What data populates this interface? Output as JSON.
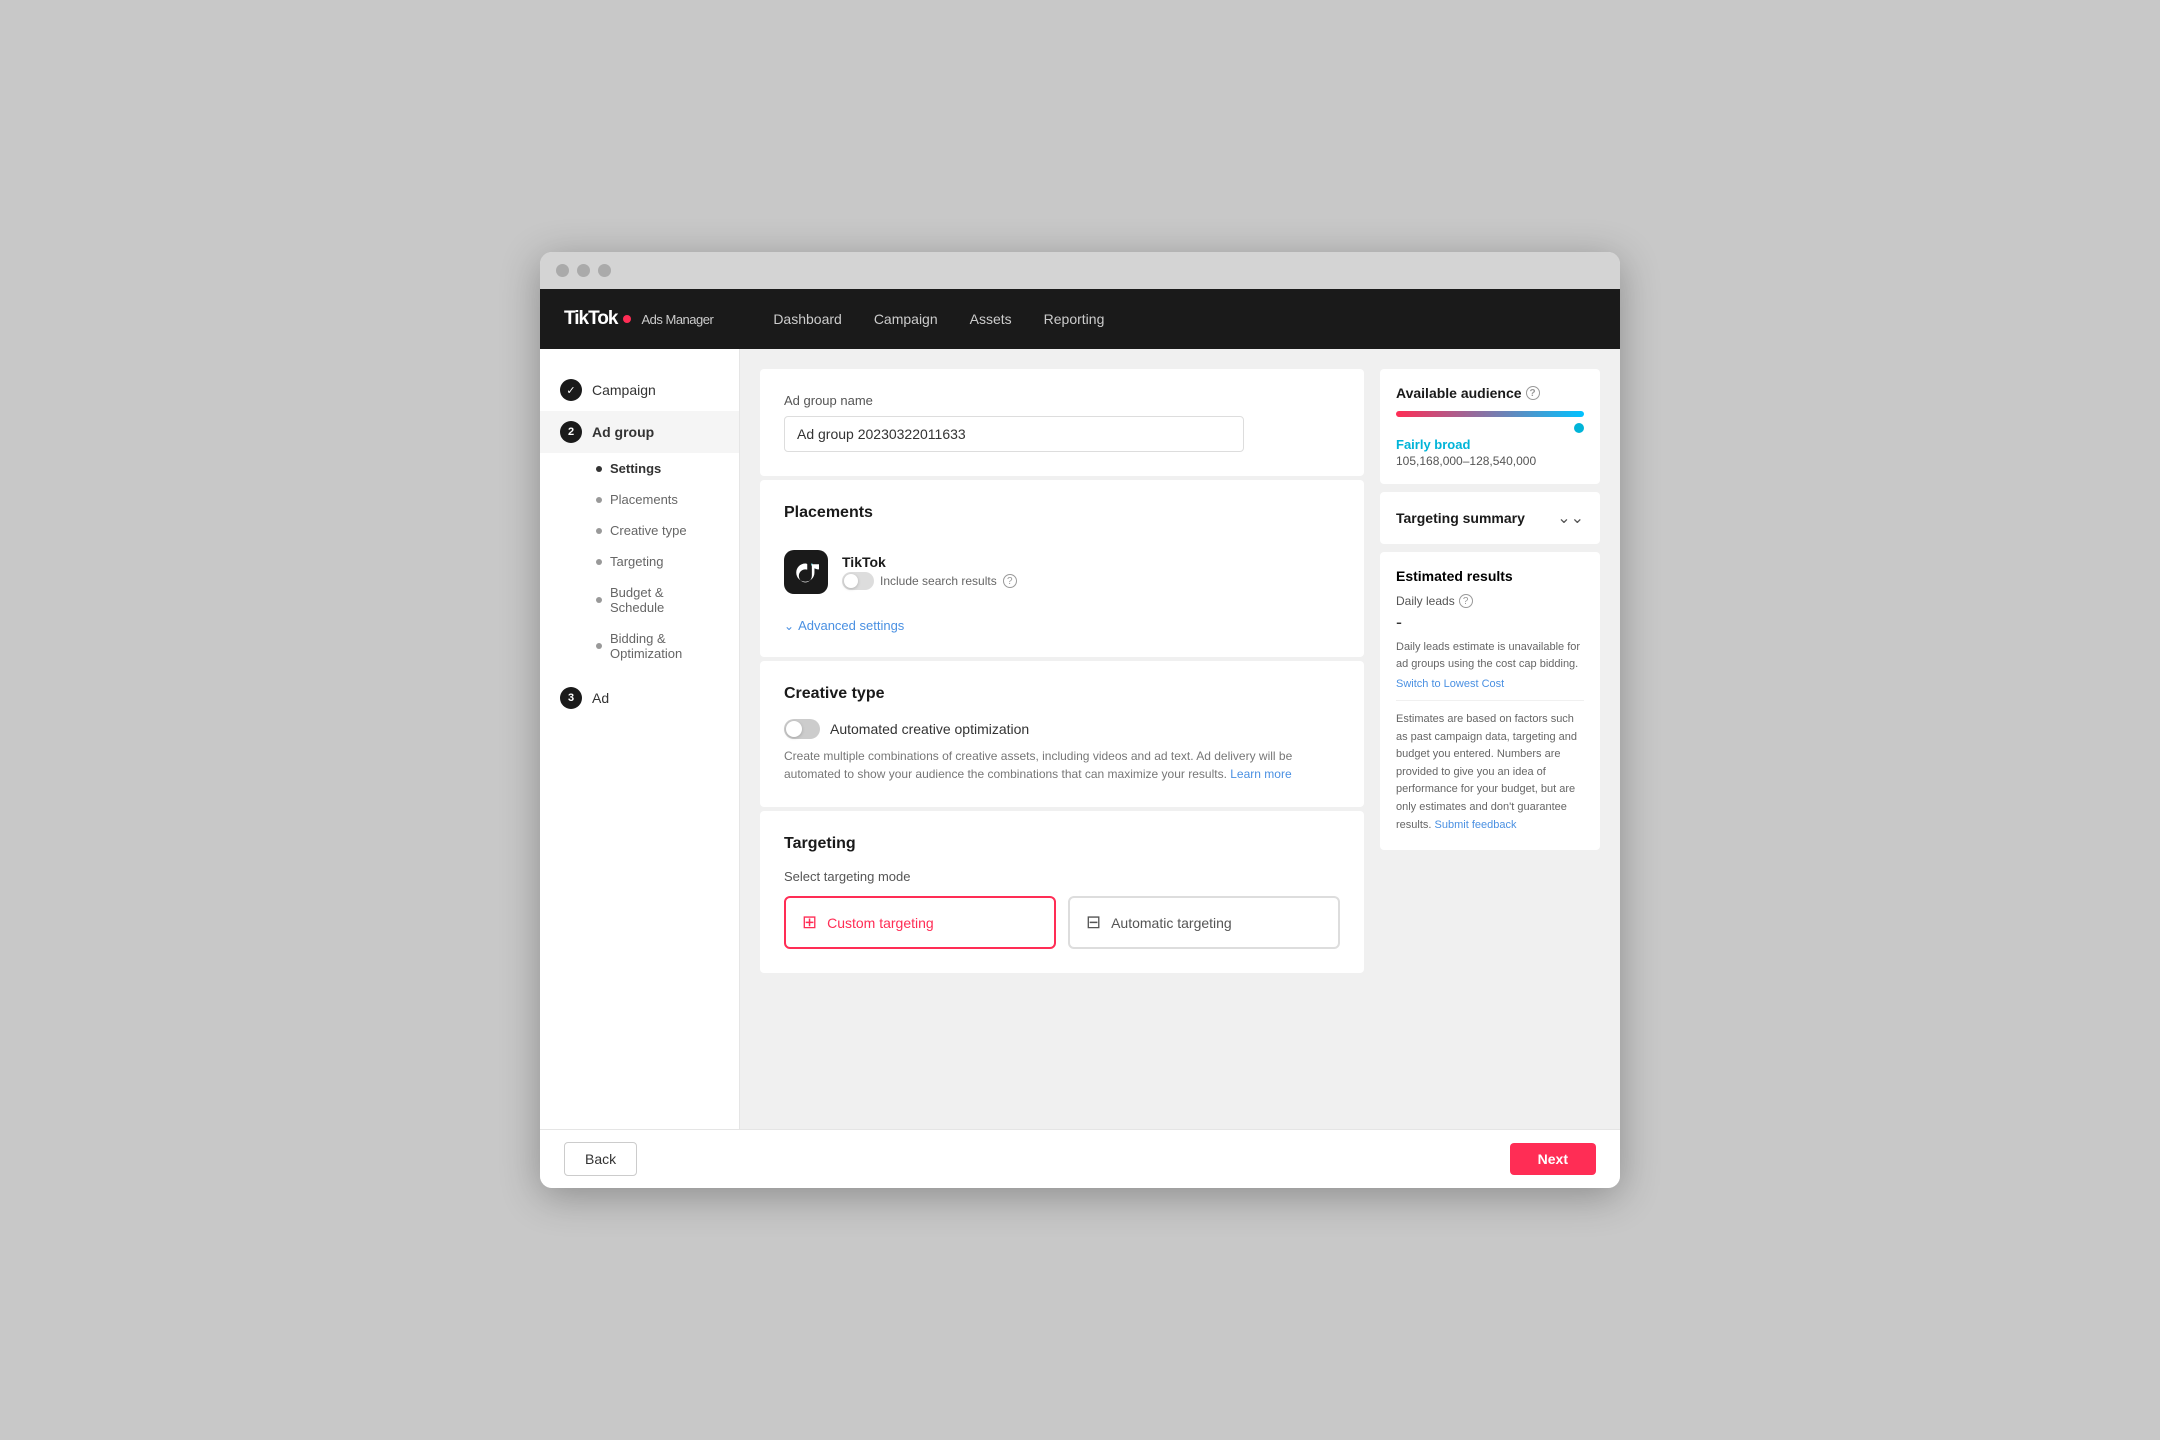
{
  "window": {
    "title": "TikTok Ads Manager"
  },
  "topnav": {
    "logo": "TikTok",
    "logo_sub": "Ads Manager",
    "items": [
      {
        "label": "Dashboard"
      },
      {
        "label": "Campaign"
      },
      {
        "label": "Assets"
      },
      {
        "label": "Reporting"
      }
    ]
  },
  "sidebar": {
    "steps": [
      {
        "id": "campaign",
        "label": "Campaign",
        "type": "completed",
        "icon": "✓"
      },
      {
        "id": "adgroup",
        "label": "Ad group",
        "type": "active",
        "number": "2"
      },
      {
        "id": "ad",
        "label": "Ad",
        "type": "pending",
        "number": "3"
      }
    ],
    "sub_items": [
      {
        "label": "Settings",
        "active": true
      },
      {
        "label": "Placements",
        "active": false
      },
      {
        "label": "Creative type",
        "active": false
      },
      {
        "label": "Targeting",
        "active": false
      },
      {
        "label": "Budget & Schedule",
        "active": false
      },
      {
        "label": "Bidding & Optimization",
        "active": false
      }
    ]
  },
  "adgroup_section": {
    "title": "Ad group name",
    "input_value": "Ad group 20230322011633",
    "input_placeholder": "Ad group 20230322011633"
  },
  "placements_section": {
    "title": "Placements",
    "platform": "TikTok",
    "include_search_label": "Include search results",
    "advanced_link": "Advanced settings"
  },
  "creative_section": {
    "title": "Creative type",
    "toggle_label": "Automated creative optimization",
    "description": "Create multiple combinations of creative assets, including videos and ad text. Ad delivery will be automated to show your audience the combinations that can maximize your results.",
    "learn_more": "Learn more"
  },
  "targeting_section": {
    "title": "Targeting",
    "mode_label": "Select targeting mode",
    "options": [
      {
        "id": "custom",
        "label": "Custom targeting",
        "selected": true
      },
      {
        "id": "automatic",
        "label": "Automatic targeting",
        "selected": false
      }
    ]
  },
  "right_panel": {
    "audience": {
      "title": "Available audience",
      "breadth": "Fairly broad",
      "range": "105,168,000–128,540,000"
    },
    "targeting_summary": {
      "title": "Targeting summary"
    },
    "estimated_results": {
      "title": "Estimated results",
      "daily_leads_label": "Daily leads",
      "daily_leads_value": "-",
      "unavailable_desc": "Daily leads estimate is unavailable for ad groups using the cost cap bidding.",
      "switch_link": "Switch to Lowest Cost",
      "notes": "Estimates are based on factors such as past campaign data, targeting and budget you entered. Numbers are provided to give you an idea of performance for your budget, but are only estimates and don't guarantee results.",
      "submit_feedback": "Submit feedback"
    }
  },
  "bottom_bar": {
    "back_label": "Back",
    "next_label": "Next"
  }
}
